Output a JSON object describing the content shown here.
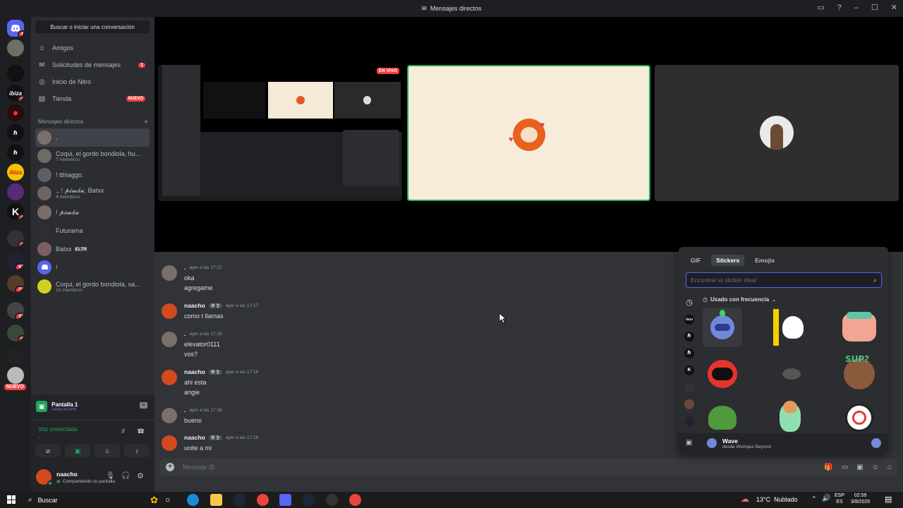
{
  "window": {
    "title": "Mensajes directos"
  },
  "sidebar": {
    "search_label": "Buscar o iniciar una conversación",
    "nav": [
      {
        "label": "Amigos",
        "icon": "friends-icon"
      },
      {
        "label": "Solicitudes de mensajes",
        "icon": "mail-icon",
        "badge": "1"
      },
      {
        "label": "Inicio de Nitro",
        "icon": "nitro-icon"
      },
      {
        "label": "Tienda",
        "icon": "shop-icon",
        "badge": "NUEVO"
      }
    ],
    "dm_header": "Mensajes directos",
    "dms": [
      {
        "name": "."
      },
      {
        "name": "Coqui, el gordo bondiola, hu...",
        "sub": "7 miembros"
      },
      {
        "name": "! tthiaggo."
      },
      {
        "name": "., ! 𝓹𝓲𝓶𝓫𝓾, Batxx",
        "sub": "4 miembros"
      },
      {
        "name": "! 𝓹𝓲𝓶𝓫𝓾"
      },
      {
        "name": "Futurama"
      },
      {
        "name": "Batxx",
        "tag": "ELTR"
      },
      {
        "name": "!"
      },
      {
        "name": "Coqui, el gordo bondiola, sa...",
        "sub": "10 miembros"
      }
    ]
  },
  "rail": {
    "badges": [
      "1",
      "4",
      "1",
      "4",
      "57",
      "72",
      "37",
      "5"
    ],
    "ibiza_label": "ibiza",
    "k_label": "K",
    "nuevo": "NUEVO"
  },
  "stream": {
    "screen_title": "Pantalla 1",
    "screen_sub": "1440p 60 FPS",
    "voice_status": "Voz conectada",
    "voice_channel": "."
  },
  "user": {
    "name": "naacho",
    "status": "Compartiendo su pantalla"
  },
  "stage": {
    "live_badge": "EN VIVO"
  },
  "messages": [
    {
      "author": ".",
      "time": "ayer a las 17:17",
      "lines": [
        "oka",
        "agregame"
      ]
    },
    {
      "author": "naacho",
      "tag": "🛡🍃",
      "time": "ayer a las 17:17",
      "lines": [
        "como t llamas"
      ]
    },
    {
      "author": ".",
      "time": "ayer a las 17:18",
      "lines": [
        "elevator0111",
        "vos?"
      ]
    },
    {
      "author": "naacho",
      "tag": "🛡🍃",
      "time": "ayer a las 17:18",
      "lines": [
        "ahi esta",
        "angie"
      ]
    },
    {
      "author": ".",
      "time": "ayer a las 17:18",
      "lines": [
        "bueno"
      ]
    },
    {
      "author": "naacho",
      "tag": "🛡🍃",
      "time": "ayer a las 17:19",
      "lines": [
        "unite a mi"
      ]
    }
  ],
  "composer": {
    "placeholder": "Mensaje @."
  },
  "picker": {
    "tabs": [
      "GIF",
      "Stickers",
      "Emojis"
    ],
    "selected_tab": "Stickers",
    "search_placeholder": "Encontrar el sticker ideal",
    "group_label": "Usado con frecuencia",
    "cat_ibiza": "ibiza",
    "cat_k": "K",
    "footer_name": "Wave",
    "footer_sub": "desde Wumpus Beyond"
  },
  "taskbar": {
    "search": "Buscar",
    "weather": "13°C  Nublado",
    "lang1": "ESP",
    "lang2": "ES",
    "time": "02:59",
    "date": "3/8/2025"
  }
}
